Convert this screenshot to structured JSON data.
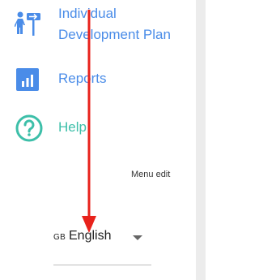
{
  "nav": {
    "items": [
      {
        "label": "Individual Development Plan",
        "icon": "person-signpost-icon"
      },
      {
        "label": "Reports",
        "icon": "bar-chart-icon"
      },
      {
        "label": "Help",
        "icon": "help-circle-icon"
      }
    ]
  },
  "menu_edit_label": "Menu edit",
  "language": {
    "code": "GB",
    "name": "English"
  },
  "colors": {
    "nav_text": "#4a8ce8",
    "help_green": "#3dbfa9",
    "icon_blue": "#4a8ce8",
    "arrow": "#e8221b"
  }
}
